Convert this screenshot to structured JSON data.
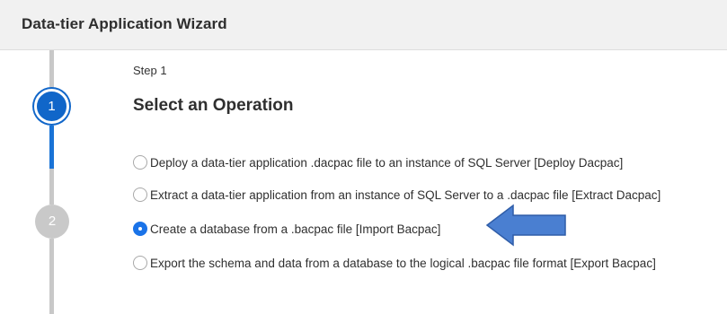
{
  "window": {
    "title": "Data-tier Application Wizard"
  },
  "stepper": {
    "steps": [
      {
        "number": "1",
        "state": "active"
      },
      {
        "number": "2",
        "state": "inactive"
      }
    ],
    "colors": {
      "active": "#1066c9",
      "inactive": "#c9c9c9"
    }
  },
  "main": {
    "step_label": "Step 1",
    "heading": "Select an Operation",
    "options": [
      {
        "label": "Deploy a data-tier application .dacpac file to an instance of SQL Server [Deploy Dacpac]",
        "selected": false
      },
      {
        "label": "Extract a data-tier application from an instance of SQL Server to a .dacpac file [Extract Dacpac]",
        "selected": false
      },
      {
        "label": "Create a database from a .bacpac file [Import Bacpac]",
        "selected": true
      },
      {
        "label": "Export the schema and data from a database to the logical .bacpac file format [Export Bacpac]",
        "selected": false
      }
    ]
  },
  "annotation": {
    "icon": "left-arrow-icon",
    "color": "#4a7fd1"
  }
}
